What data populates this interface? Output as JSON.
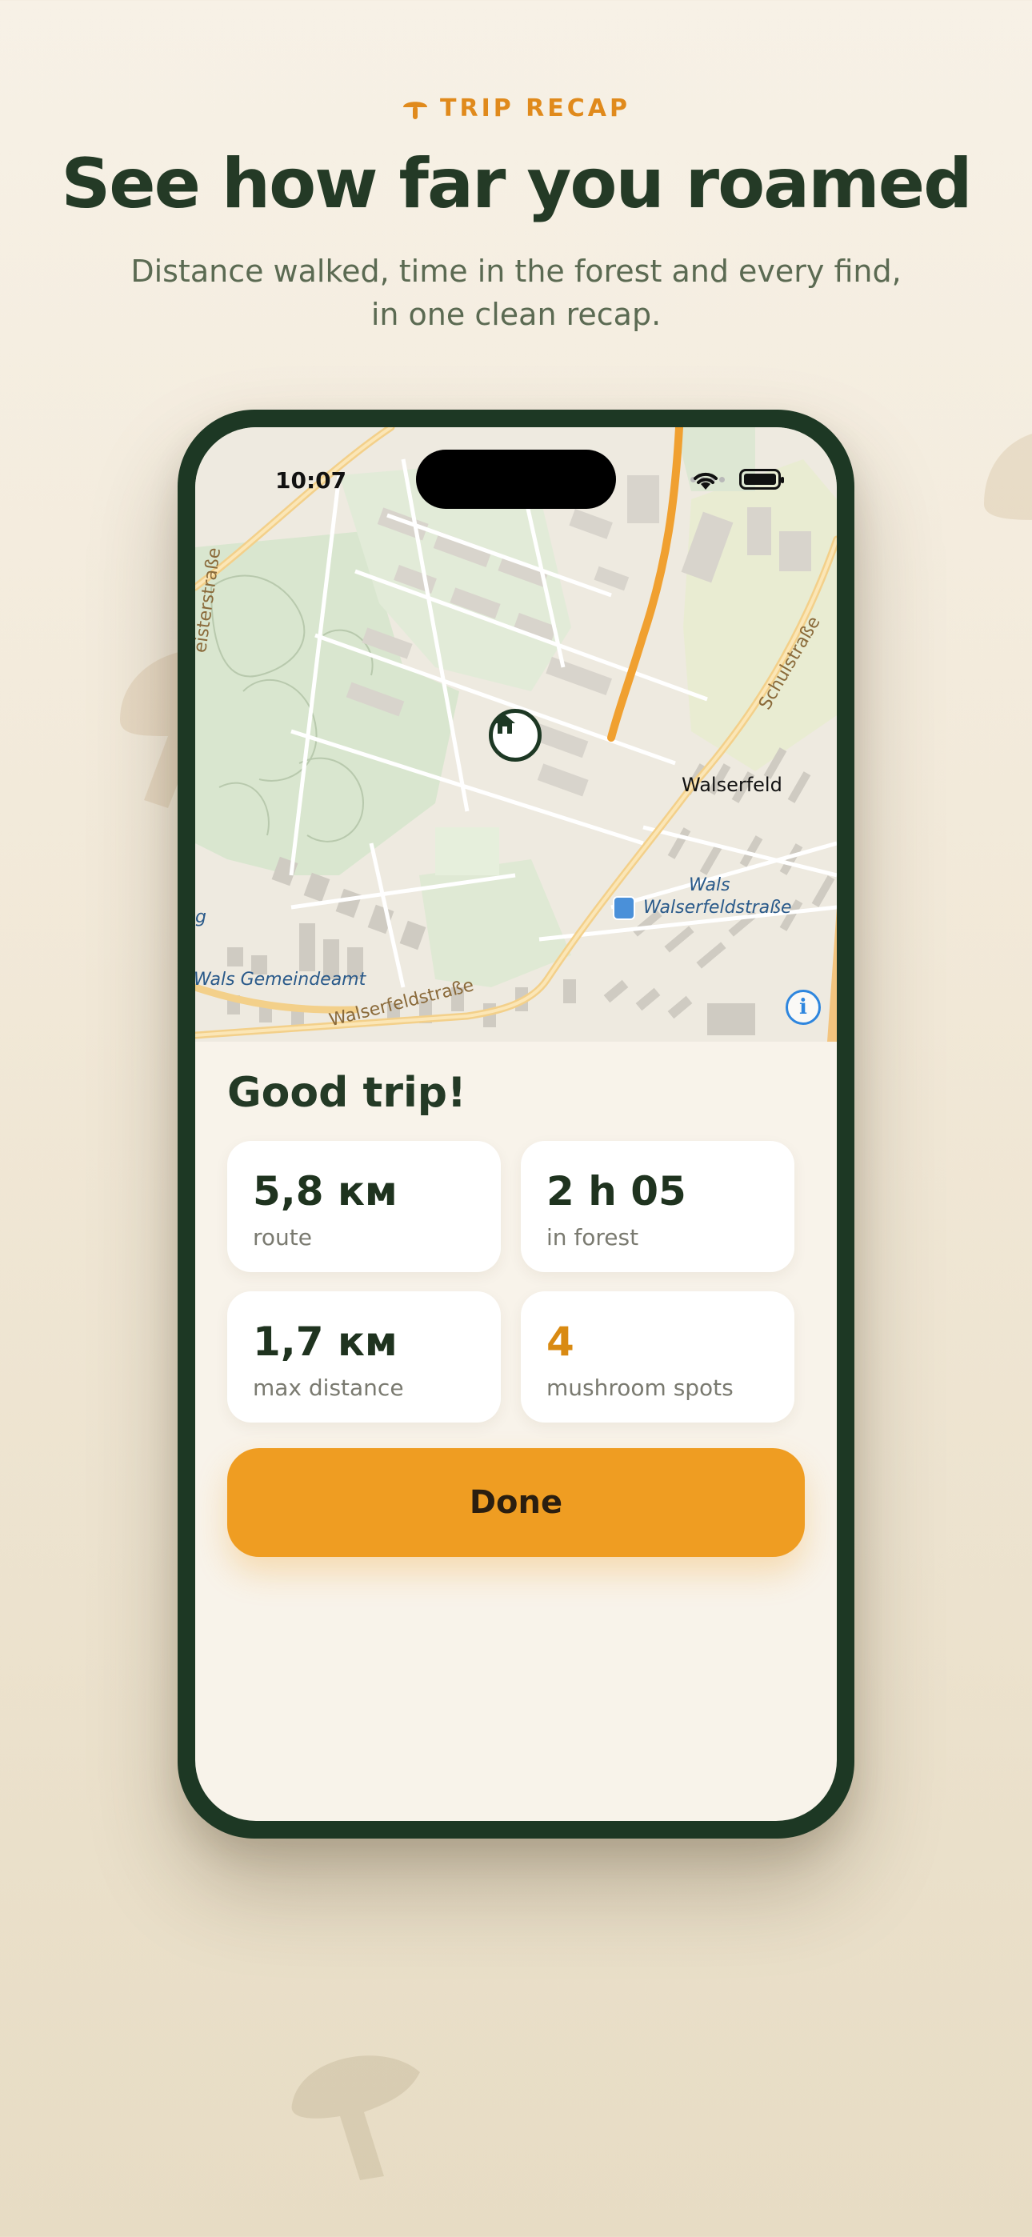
{
  "promo": {
    "eyebrow": "TRIP RECAP",
    "headline": "See how far you roamed",
    "subhead_line1": "Distance walked, time in the forest and every find,",
    "subhead_line2": "in one clean recap.",
    "accent_color": "#e08a1c"
  },
  "status_bar": {
    "time": "10:07"
  },
  "map": {
    "labels": {
      "walserfeld": "Walserfeld",
      "schulstrasse": "Schulstraße",
      "wals": "Wals",
      "walserfeldstrasse_stop": "Walserfeldstraße",
      "walserfeldstrasse_road": "Walserfeldstraße",
      "gemeindeamt": "Wals Gemeindeamt",
      "meisterstrasse": "eisterstraße",
      "edge_g": "g"
    },
    "route_color": "#f0a030",
    "pin_icon": "home-icon",
    "info_icon": "i"
  },
  "summary": {
    "title": "Good trip!",
    "stats": [
      {
        "value": "5,8 км",
        "label": "route"
      },
      {
        "value": "2 h 05",
        "label": "in forest"
      },
      {
        "value": "1,7 км",
        "label": "max distance"
      },
      {
        "value": "4",
        "label": "mushroom spots",
        "accent": true
      }
    ],
    "done_label": "Done",
    "done_color": "#ef9d22"
  }
}
